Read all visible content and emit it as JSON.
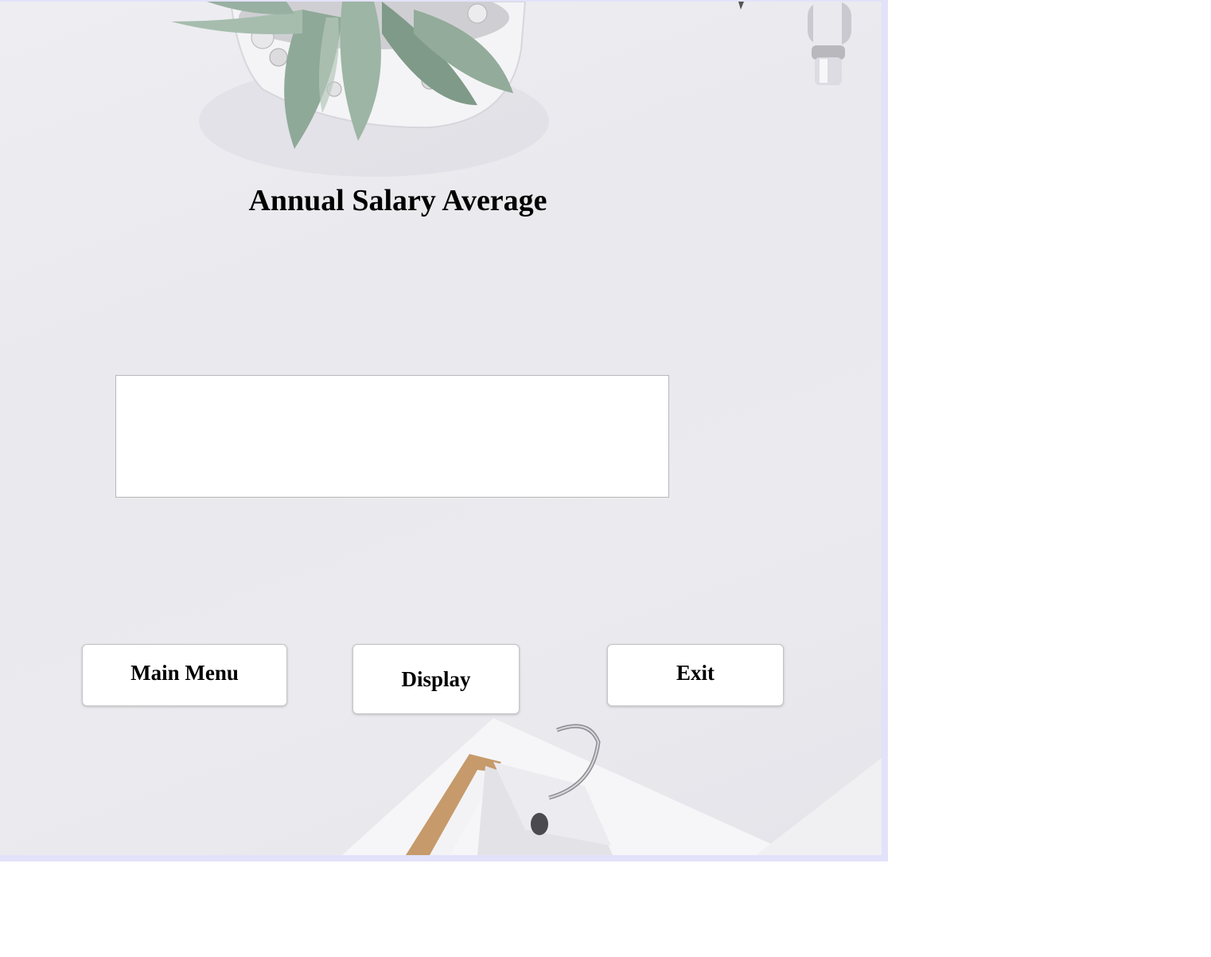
{
  "app": {
    "title": "Annual Salary Average"
  },
  "output": {
    "value": ""
  },
  "buttons": {
    "main_menu": "Main Menu",
    "display": "Display",
    "exit": "Exit"
  },
  "colors": {
    "frame": "#e2e2fa",
    "desk": "#ebebef",
    "button_bg": "#ffffff"
  }
}
